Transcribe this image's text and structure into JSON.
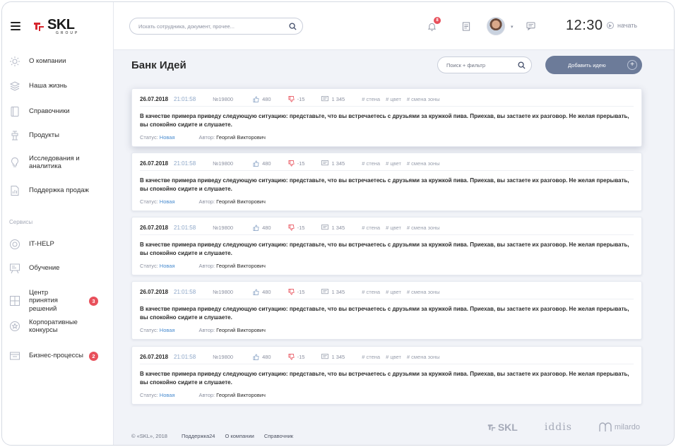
{
  "app": {
    "logo_text": "SKL",
    "logo_sub": "GROUP"
  },
  "sidebar": {
    "items": [
      {
        "label": "О компании",
        "icon": "sun-icon"
      },
      {
        "label": "Наша жизнь",
        "icon": "layers-icon"
      },
      {
        "label": "Справочники",
        "icon": "book-icon"
      },
      {
        "label": "Продукты",
        "icon": "faucet-icon"
      },
      {
        "label": "Исследования и аналитика",
        "icon": "bulb-icon"
      },
      {
        "label": "Поддержка продаж",
        "icon": "chart-doc-icon"
      }
    ],
    "services_title": "Сервисы",
    "services": [
      {
        "label": "IT-HELP",
        "icon": "lifebuoy-icon",
        "badge": ""
      },
      {
        "label": "Обучение",
        "icon": "board-icon",
        "badge": ""
      },
      {
        "label": "Центр принятия решений",
        "icon": "puzzle-icon",
        "badge": "3"
      },
      {
        "label": "Корпоративные конкурсы",
        "icon": "star-icon",
        "badge": ""
      },
      {
        "label": "Бизнес-процессы",
        "icon": "flow-icon",
        "badge": "2"
      }
    ]
  },
  "topbar": {
    "search_placeholder": "Искать сотрудника, документ, прочее...",
    "notifications_count": "8",
    "time": "12:30",
    "start_label": "начать"
  },
  "main": {
    "title": "Банк Идей",
    "filter_placeholder": "Поиск + фильтр",
    "add_label": "Добавить идею"
  },
  "ideas": [
    {
      "date": "26.07.2018",
      "time": "21:01:58",
      "number": "№19800",
      "likes": "480",
      "dislikes": "-15",
      "comments": "1 345",
      "tags": [
        "# стена",
        "# цвет",
        "# смена зоны"
      ],
      "text": "В качестве примера приведу следующую ситуацию: представьте, что вы встречаетесь с друзьями за кружкой пива. Приехав, вы застаете их разговор. Не желая прерывать, вы спокойно сидите и слушаете.",
      "status_label": "Статус:",
      "status": "Новая",
      "author_label": "Автор:",
      "author": "Георгий Викторович"
    },
    {
      "date": "26.07.2018",
      "time": "21:01:58",
      "number": "№19800",
      "likes": "480",
      "dislikes": "-15",
      "comments": "1 345",
      "tags": [
        "# стена",
        "# цвет",
        "# смена зоны"
      ],
      "text": "В качестве примера приведу следующую ситуацию: представьте, что вы встречаетесь с друзьями за кружкой пива. Приехав, вы застаете их разговор. Не желая прерывать, вы спокойно сидите и слушаете.",
      "status_label": "Статус:",
      "status": "Новая",
      "author_label": "Автор:",
      "author": "Георгий Викторович"
    },
    {
      "date": "26.07.2018",
      "time": "21:01:58",
      "number": "№19800",
      "likes": "480",
      "dislikes": "-15",
      "comments": "1 345",
      "tags": [
        "# стена",
        "# цвет",
        "# смена зоны"
      ],
      "text": "В качестве примера приведу следующую ситуацию: представьте, что вы встречаетесь с друзьями за кружкой пива. Приехав, вы застаете их разговор. Не желая прерывать, вы спокойно сидите и слушаете.",
      "status_label": "Статус:",
      "status": "Новая",
      "author_label": "Автор:",
      "author": "Георгий Викторович"
    },
    {
      "date": "26.07.2018",
      "time": "21:01:58",
      "number": "№19800",
      "likes": "480",
      "dislikes": "-15",
      "comments": "1 345",
      "tags": [
        "# стена",
        "# цвет",
        "# смена зоны"
      ],
      "text": "В качестве примера приведу следующую ситуацию: представьте, что вы встречаетесь с друзьями за кружкой пива. Приехав, вы застаете их разговор. Не желая прерывать, вы спокойно сидите и слушаете.",
      "status_label": "Статус:",
      "status": "Новая",
      "author_label": "Автор:",
      "author": "Георгий Викторович"
    },
    {
      "date": "26.07.2018",
      "time": "21:01:58",
      "number": "№19800",
      "likes": "480",
      "dislikes": "-15",
      "comments": "1 345",
      "tags": [
        "# стена",
        "# цвет",
        "# смена зоны"
      ],
      "text": "В качестве примера приведу следующую ситуацию: представьте, что вы встречаетесь с друзьями за кружкой пива. Приехав, вы застаете их разговор. Не желая прерывать, вы спокойно сидите и слушаете.",
      "status_label": "Статус:",
      "status": "Новая",
      "author_label": "Автор:",
      "author": "Георгий Викторович"
    }
  ],
  "footer": {
    "copyright": "© «SKL», 2018",
    "links": [
      "Поддержка24",
      "О компании",
      "Справочник"
    ],
    "partners": [
      "SKL",
      "iddis",
      "milardo"
    ]
  },
  "colors": {
    "accent": "#6c7b99",
    "badge": "#e8505b",
    "status_link": "#4a8ccf",
    "logo_red": "#d7262e"
  }
}
